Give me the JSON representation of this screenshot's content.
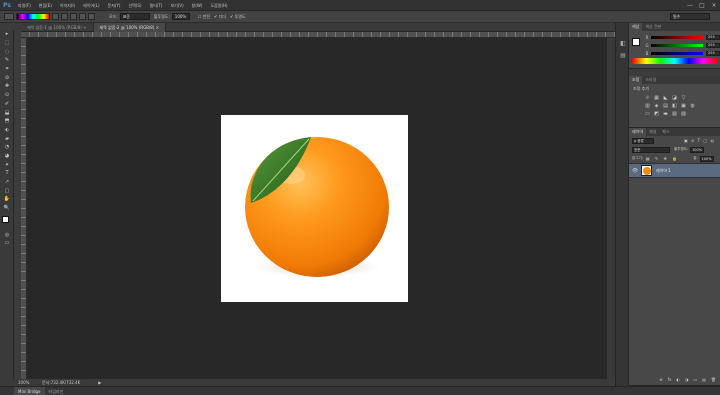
{
  "app": {
    "logo": "Ps"
  },
  "menu": [
    "파일(F)",
    "편집(E)",
    "이미지(I)",
    "레이어(L)",
    "문자(Y)",
    "선택(S)",
    "필터(T)",
    "보기(V)",
    "창(W)",
    "도움말(H)"
  ],
  "window_controls": {
    "minimize": "—",
    "maximize": "□",
    "close": "×"
  },
  "options": {
    "mode_label": "모드:",
    "mode_value": "표준",
    "opacity_label": "불투명도:",
    "opacity_value": "100%",
    "reverse_label": "반전",
    "dither_label": "디더",
    "transparency_label": "투명도",
    "workspace_value": "필수"
  },
  "document_tabs": [
    {
      "label": "제목 없음-1 @ 100% (RGB/8) ×",
      "active": false
    },
    {
      "label": "제목 없음-2 @ 100% (RGB/8) ×",
      "active": true
    }
  ],
  "status": {
    "zoom": "100%",
    "doc_info": "문서:732.4K/732.4K",
    "arrow": "▶"
  },
  "bottom_tabs": [
    "Mini Bridge",
    "타임라인"
  ],
  "color_panel": {
    "tabs": [
      "색상",
      "색상 견본"
    ],
    "sliders": [
      {
        "label": "R",
        "value": "255",
        "gradient": "linear-gradient(to right,#000,#ff0000)"
      },
      {
        "label": "G",
        "value": "255",
        "gradient": "linear-gradient(to right,#000,#00ff00)"
      },
      {
        "label": "B",
        "value": "255",
        "gradient": "linear-gradient(to right,#000,#0000ff)"
      }
    ]
  },
  "adjustments_panel": {
    "tabs": [
      "조정",
      "스타일"
    ],
    "title": "조정 추가",
    "rows": [
      [
        "☼",
        "▦",
        "◣",
        "◪",
        "▽"
      ],
      [
        "▥",
        "◈",
        "▤",
        "◧",
        "▣",
        "◍"
      ],
      [
        "▭",
        "◩",
        "▬",
        "▧",
        "▨"
      ]
    ]
  },
  "layers_panel": {
    "tabs": [
      "레이어",
      "채널",
      "패스"
    ],
    "kind_label": "종류",
    "blend_value": "표준",
    "opacity_label": "불투명도:",
    "opacity_value": "100%",
    "lock_label": "잠그기:",
    "fill_label": "칠:",
    "fill_value": "100%",
    "layer_name": "레이어 1",
    "bottom_icons": [
      "⊕",
      "fx",
      "◐",
      "◑",
      "▭",
      "▤",
      "🗑"
    ]
  },
  "tools": [
    "▸",
    "⬚",
    "◌",
    "✎",
    "⌗",
    "⊘",
    "✚",
    "⊙",
    "✐",
    "⬓",
    "⬒",
    "⬖",
    "▰",
    "◔",
    "◕",
    "✦",
    "T",
    "↗",
    "▢",
    "✋",
    "🔍"
  ],
  "colors": {
    "foreground": "#ffffff",
    "background": "#e03b3b",
    "accent": "#4b90d6"
  }
}
